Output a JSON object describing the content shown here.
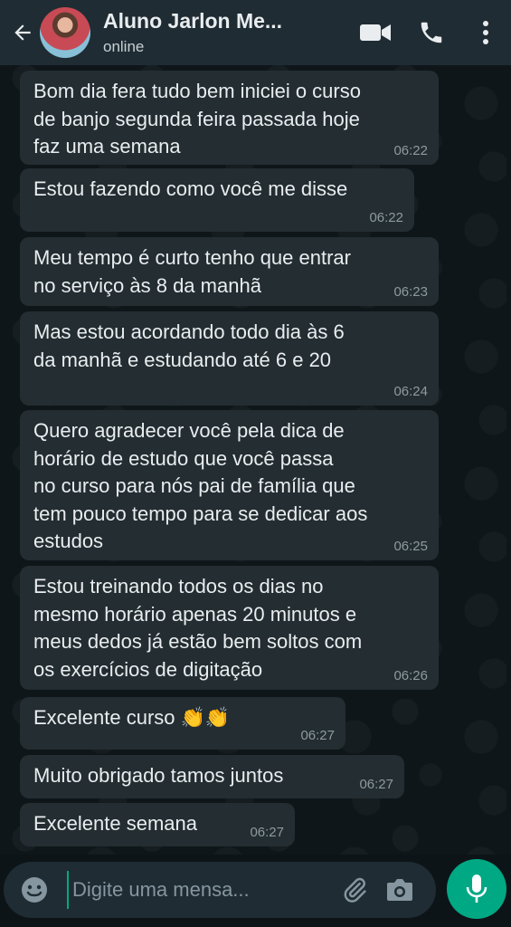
{
  "header": {
    "contact_name": "Aluno Jarlon Me...",
    "status": "online",
    "icons": [
      "back-arrow-icon",
      "avatar",
      "video-call-icon",
      "phone-icon",
      "more-vertical-icon"
    ]
  },
  "messages": [
    {
      "text": "Bom dia fera tudo bem iniciei o curso\nde banjo segunda feira passada hoje\nfaz uma semana",
      "time": "06:22"
    },
    {
      "text": "Estou fazendo como você me disse",
      "time": "06:22"
    },
    {
      "text": "Meu tempo é curto tenho que entrar\nno serviço às 8 da manhã",
      "time": "06:23"
    },
    {
      "text": "Mas estou acordando todo dia às 6\nda manhã e estudando até 6 e 20",
      "time": "06:24"
    },
    {
      "text": "Quero agradecer você pela dica de\nhorário de estudo que você passa\nno curso para nós pai de família que\ntem pouco tempo para se dedicar aos\nestudos",
      "time": "06:25"
    },
    {
      "text": "Estou treinando todos os dias no\nmesmo horário apenas 20 minutos e\nmeus dedos já estão bem soltos com\nos exercícios de digitação",
      "time": "06:26"
    },
    {
      "text": "Excelente curso",
      "emoji": "👏👏",
      "time": "06:27"
    },
    {
      "text": "Muito obrigado tamos juntos",
      "time": "06:27"
    },
    {
      "text": "Excelente semana",
      "time": "06:27"
    }
  ],
  "composer": {
    "placeholder": "Digite uma mensa...",
    "icons": [
      "emoji-icon",
      "attach-icon",
      "camera-icon",
      "mic-icon"
    ]
  },
  "colors": {
    "header_bg": "#1f2c33",
    "bubble_bg": "#232d32",
    "chat_bg": "#0e1619",
    "accent": "#00a884",
    "text": "#e9edef",
    "time": "#8e9a9f"
  }
}
